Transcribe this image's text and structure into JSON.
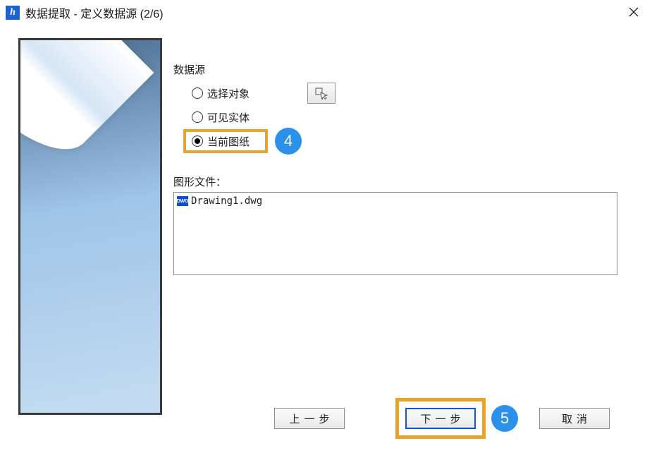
{
  "titlebar": {
    "app_initial": "h",
    "title": "数据提取 - 定义数据源 (2/6)"
  },
  "form": {
    "group_label": "数据源",
    "radio": {
      "select_objects": {
        "label": "选择对象",
        "checked": false
      },
      "visible_entities": {
        "label": "可见实体",
        "checked": false
      },
      "current_drawing": {
        "label": "当前图纸",
        "checked": true
      }
    },
    "file_label": "图形文件：",
    "file_item": {
      "icon_text": "DWG",
      "name": "Drawing1.dwg"
    }
  },
  "footer": {
    "back": "上一步",
    "next": "下一步",
    "cancel": "取消"
  },
  "callouts": {
    "four": "4",
    "five": "5"
  }
}
